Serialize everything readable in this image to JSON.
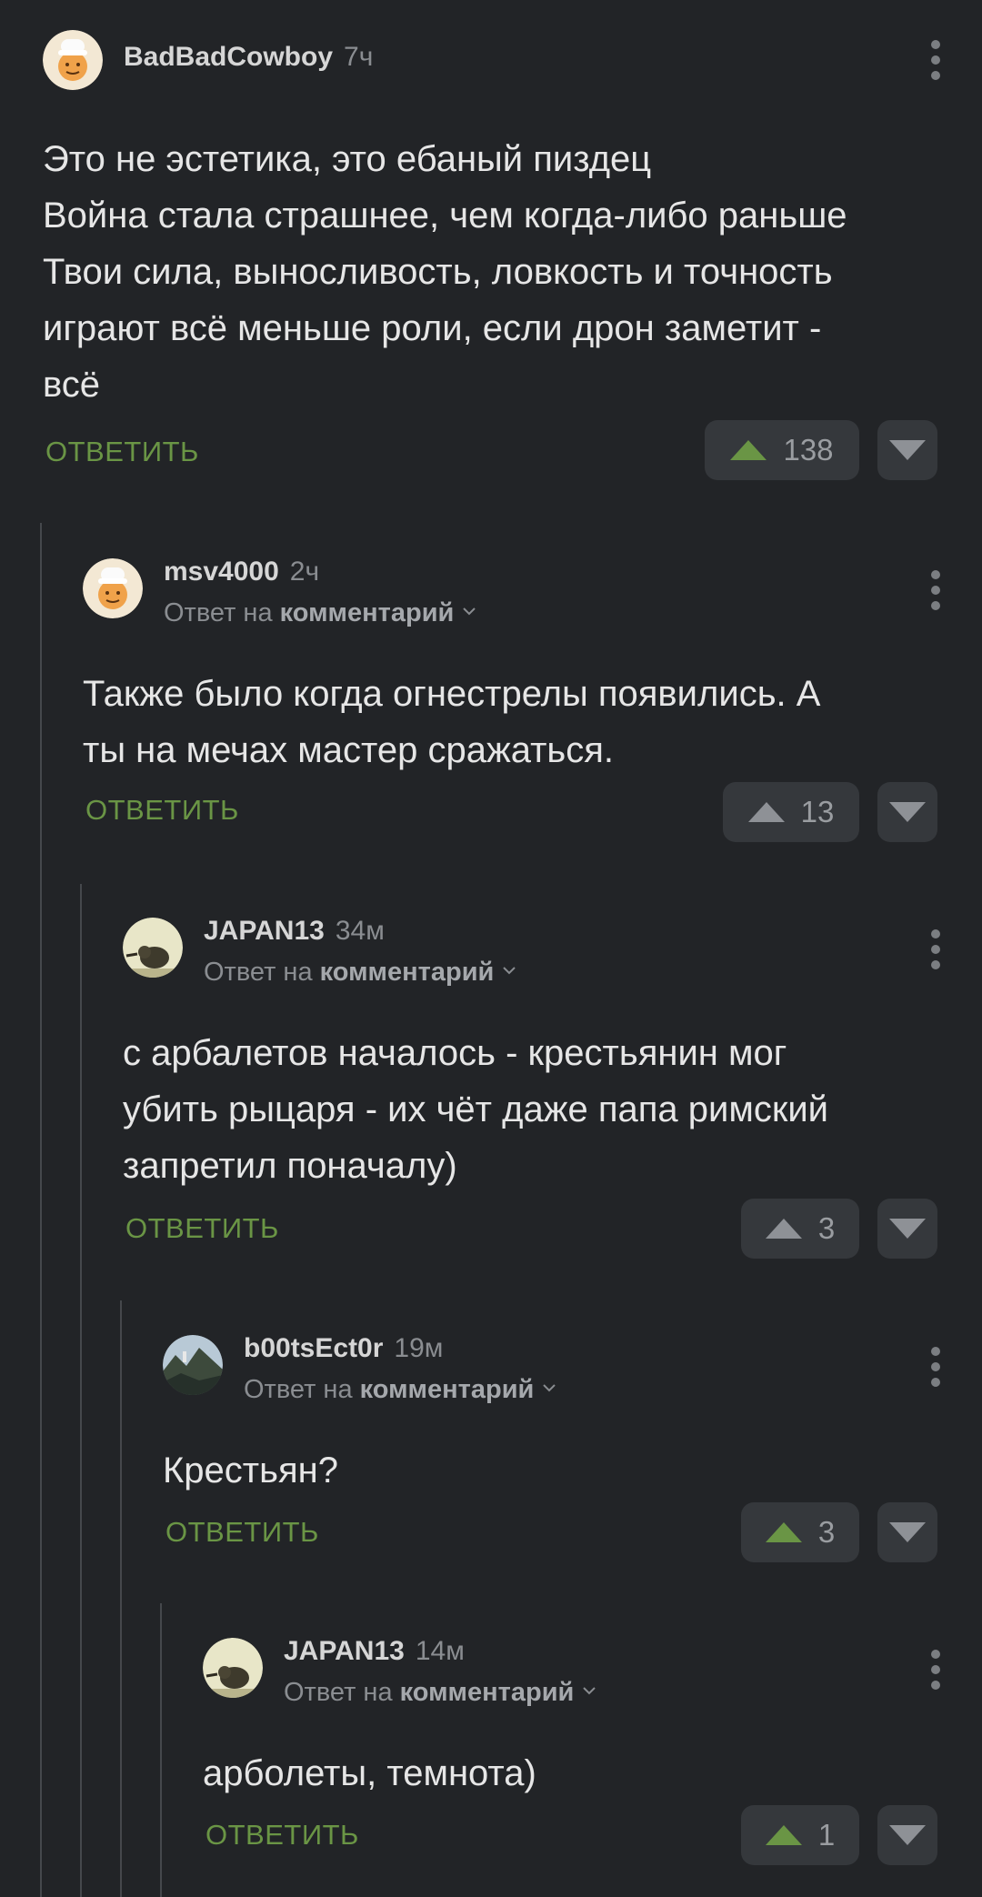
{
  "reply_label": "ОТВЕТИТЬ",
  "reply_to_prefix": "Ответ на",
  "reply_to_link": "комментарий",
  "colors": {
    "upvoted": "#6a9545",
    "neutral": "#8e9196",
    "accent_text": "#6a9545"
  },
  "comments": [
    {
      "username": "BadBadCowboy",
      "time": "7ч",
      "avatar": "cowboy-avatar",
      "lines": [
        "Это не эстетика, это ебаный пиздец",
        "Война стала страшнее, чем когда-либо раньше",
        "Твои сила, выносливость, ловкость и точность",
        "играют всё меньше роли, если дрон заметит -",
        "всё"
      ],
      "votes": "138",
      "upvoted": true
    },
    {
      "username": "msv4000",
      "time": "2ч",
      "avatar": "cowboy-avatar",
      "lines": [
        "Также было когда огнестрелы появились. А",
        "ты на мечах мастер сражаться."
      ],
      "votes": "13",
      "upvoted": false
    },
    {
      "username": "JAPAN13",
      "time": "34м",
      "avatar": "hedgehog-avatar",
      "lines": [
        "с арбалетов началось - крестьянин мог",
        "убить рыцаря - их чёт даже папа римский",
        "запретил поначалу)"
      ],
      "votes": "3",
      "upvoted": false
    },
    {
      "username": "b00tsEct0r",
      "time": "19м",
      "avatar": "landscape-avatar",
      "lines": [
        "Крестьян?"
      ],
      "votes": "3",
      "upvoted": true
    },
    {
      "username": "JAPAN13",
      "time": "14м",
      "avatar": "hedgehog-avatar",
      "lines": [
        "арболеты, темнота)"
      ],
      "votes": "1",
      "upvoted": true
    }
  ]
}
